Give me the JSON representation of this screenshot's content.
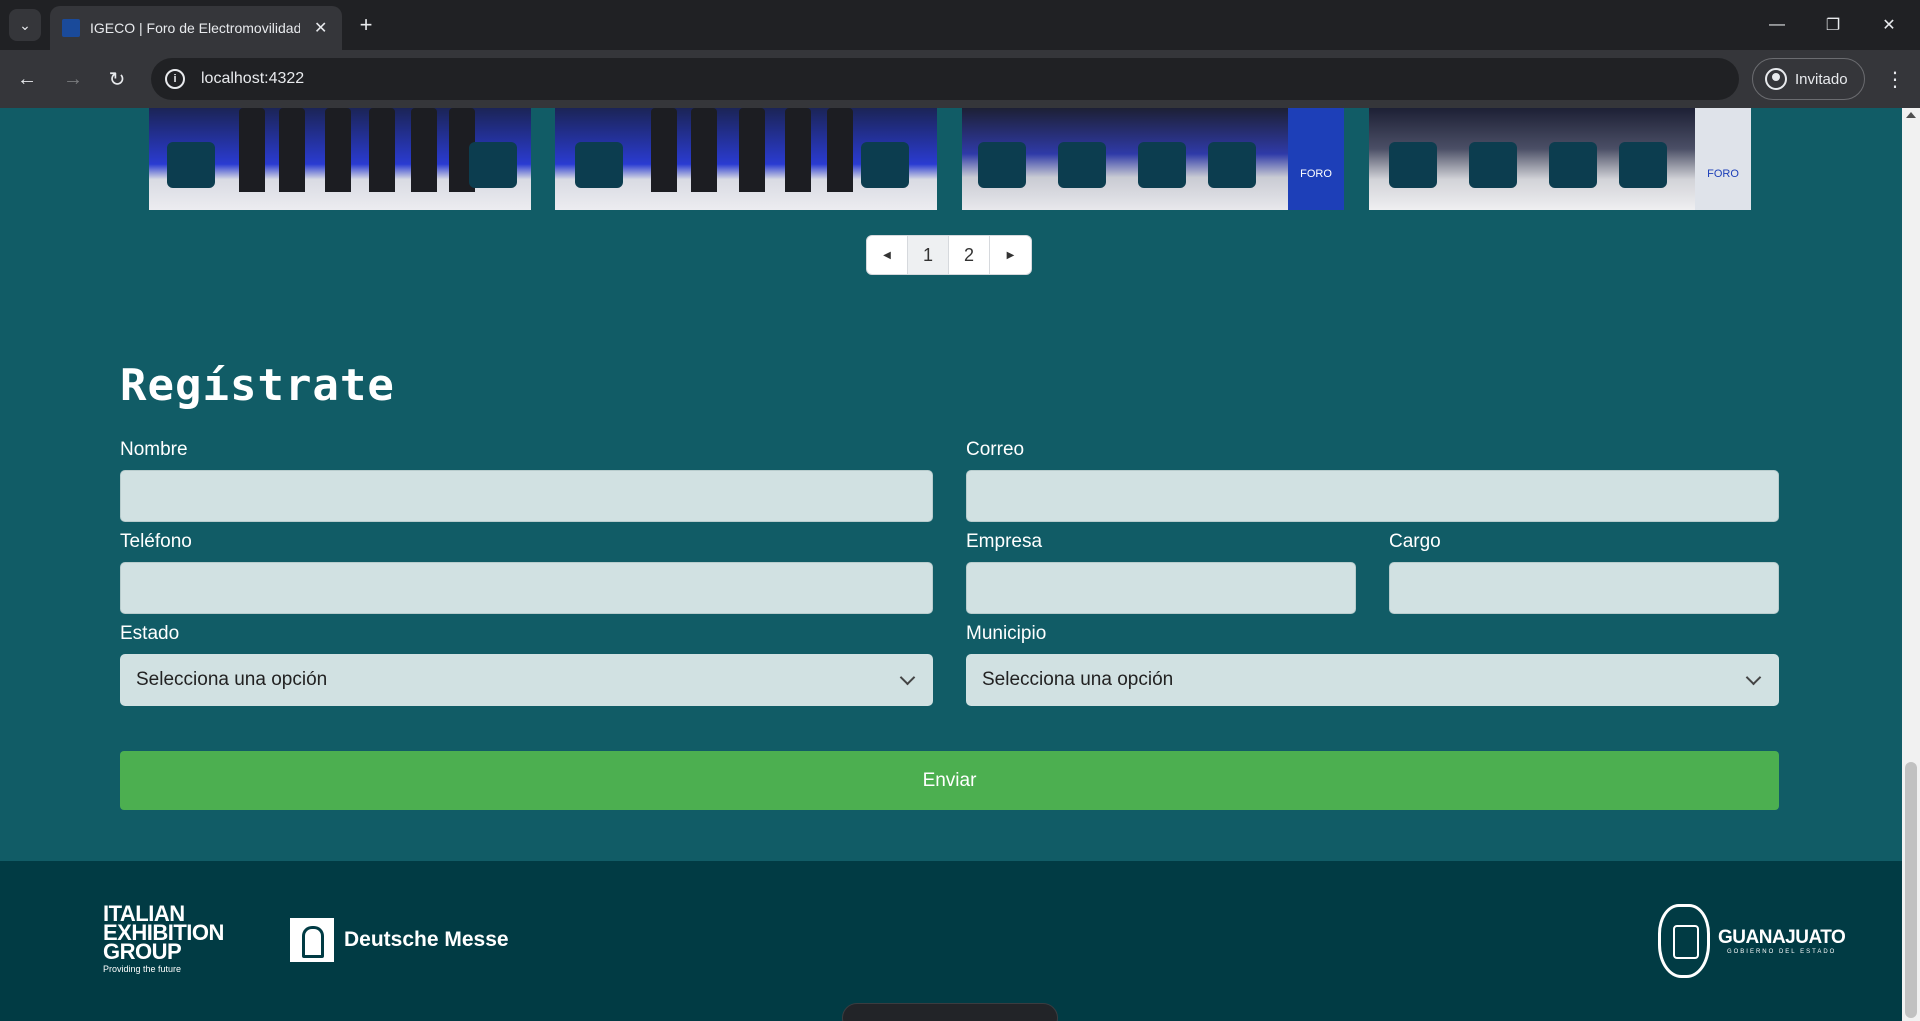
{
  "browser": {
    "tab_title": "IGECO | Foro de Electromovilidad",
    "tab_close": "✕",
    "new_tab": "+",
    "url": "localhost:4322",
    "profile_label": "Invitado",
    "icons": [
      "tab-search-icon",
      "favicon-icon",
      "close-icon",
      "plus-icon",
      "minimize-icon",
      "restore-icon",
      "close-window-icon",
      "back-icon",
      "forward-icon",
      "reload-icon",
      "info-icon",
      "profile-icon",
      "kebab-menu-icon"
    ]
  },
  "gallery": {
    "foro_sign": "FORO",
    "pagination": {
      "pages": [
        "1",
        "2"
      ],
      "active_page": "1"
    }
  },
  "form": {
    "title": "Regístrate",
    "fields": {
      "nombre": "Nombre",
      "correo": "Correo",
      "telefono": "Teléfono",
      "empresa": "Empresa",
      "cargo": "Cargo",
      "estado": "Estado",
      "municipio": "Municipio"
    },
    "select_placeholder": "Selecciona una opción",
    "submit_label": "Enviar"
  },
  "footer": {
    "italian_logo": [
      "ITALIAN",
      "EXHIBITION",
      "GROUP"
    ],
    "italian_tagline": "Providing the future",
    "deutsche_messe": "Deutsche Messe",
    "guanajuato": "GUANAJUATO",
    "guanajuato_sub": "GOBIERNO DEL ESTADO"
  },
  "colors": {
    "page_background": "#115c66",
    "footer_background": "#013b44",
    "input_background": "#d1e1e2",
    "submit_button": "#4caf50"
  }
}
